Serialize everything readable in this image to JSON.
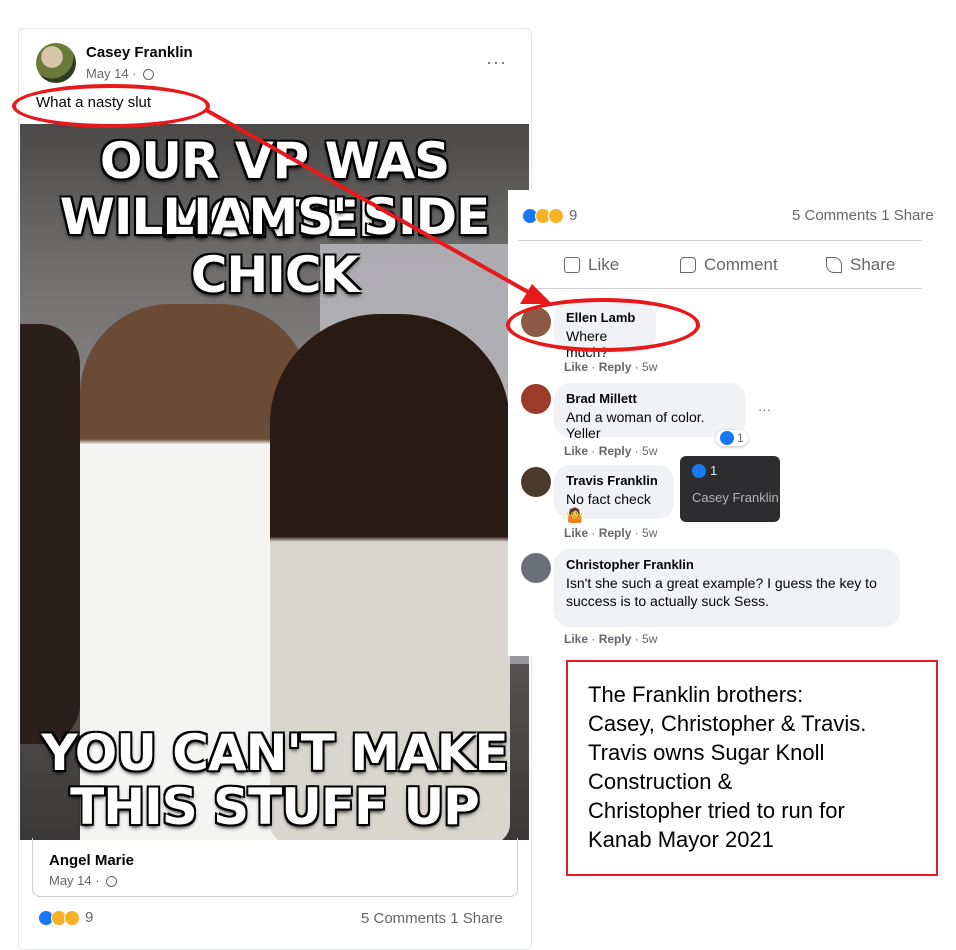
{
  "post": {
    "author": "Casey Franklin",
    "date": "May 14 · ",
    "more": "···",
    "caption": "What a nasty slut",
    "meme": {
      "top_line_1": "OUR VP WAS MONTEL",
      "top_line_2": "WILLIAMS' SIDE CHICK",
      "bottom_line_1": "YOU CAN'T MAKE",
      "bottom_line_2": "THIS STUFF UP"
    },
    "shared_author": "Angel Marie",
    "shared_date": "May 14 · ",
    "reaction_count": "9",
    "stats": "5 Comments 1 Share"
  },
  "panel": {
    "reaction_count": "9",
    "stats": "5 Comments 1 Share",
    "actions": {
      "like": "Like",
      "comment": "Comment",
      "share": "Share"
    },
    "comments": [
      {
        "name": "Ellen Lamb",
        "text": "Where much?",
        "meta_like": "Like",
        "meta_reply": "Reply",
        "meta_time": "5w"
      },
      {
        "name": "Brad Millett",
        "text": "And a woman of color. Yeller",
        "meta_like": "Like",
        "meta_reply": "Reply",
        "meta_time": "5w",
        "reactions": "1"
      },
      {
        "name": "Travis Franklin",
        "text": "No fact check 🤷",
        "meta_like": "Like",
        "meta_reply": "Reply",
        "meta_time": "5w"
      },
      {
        "name": "Christopher Franklin",
        "text_line_1": "Isn't she such a great example? I guess the key to",
        "text_line_2": "success is to actually suck Sess.",
        "meta_like": "Like",
        "meta_reply": "Reply",
        "meta_time": "5w"
      }
    ],
    "tooltip": {
      "count": "1",
      "name": "Casey Franklin"
    }
  },
  "note": {
    "line_1": "The Franklin brothers:",
    "line_2": "Casey, Christopher & Travis.",
    "line_3": "Travis owns Sugar Knoll",
    "line_4": "Construction &",
    "line_5": "Christopher tried to run for",
    "line_6": "Kanab Mayor 2021"
  },
  "colors": {
    "annotation_red": "#e8191b",
    "facebook_blue": "#1877f2",
    "meta_gray": "#65676b"
  }
}
